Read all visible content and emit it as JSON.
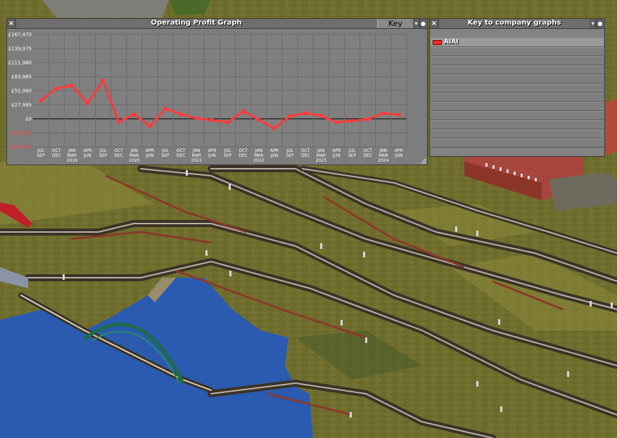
{
  "graph_window": {
    "title": "Operating Profit Graph",
    "key_label": "Key",
    "close_icon": "×"
  },
  "key_window": {
    "title": "Key to company graphs",
    "close_icon": "×",
    "items": [
      {
        "label": "AIAI",
        "color": "#ff3030"
      }
    ]
  },
  "chart_data": {
    "type": "line",
    "title": "Operating Profit Graph",
    "y_ticks": [
      "£167,470",
      "£139,975",
      "£111,980",
      "£83,985",
      "£55,990",
      "£27,995",
      "£0",
      "-£27,995",
      "-£55,990"
    ],
    "ylim": [
      -55990,
      167470
    ],
    "x_ticks": [
      [
        "JUL",
        "SEP",
        ""
      ],
      [
        "OCT",
        "DEC",
        ""
      ],
      [
        "JAN",
        "MAR",
        "2019"
      ],
      [
        "APR",
        "JUN",
        ""
      ],
      [
        "JUL",
        "SEP",
        ""
      ],
      [
        "OCT",
        "DEC",
        ""
      ],
      [
        "JAN",
        "MAR",
        "2020"
      ],
      [
        "APR",
        "JUN",
        ""
      ],
      [
        "JUL",
        "SEP",
        ""
      ],
      [
        "OCT",
        "DEC",
        ""
      ],
      [
        "JAN",
        "MAR",
        "2021"
      ],
      [
        "APR",
        "JUN",
        ""
      ],
      [
        "JUL",
        "SEP",
        ""
      ],
      [
        "OCT",
        "DEC",
        ""
      ],
      [
        "JAN",
        "MAR",
        "2022"
      ],
      [
        "APR",
        "JUN",
        ""
      ],
      [
        "JUL",
        "SEP",
        ""
      ],
      [
        "OCT",
        "DEC",
        ""
      ],
      [
        "JAN",
        "MAR",
        "2023"
      ],
      [
        "APR",
        "JUN",
        ""
      ],
      [
        "JUL",
        "SEP",
        ""
      ],
      [
        "OCT",
        "DEC",
        ""
      ],
      [
        "JAN",
        "MAR",
        "2024"
      ],
      [
        "APR",
        "JUN",
        ""
      ]
    ],
    "series": [
      {
        "name": "AIAI",
        "color": "#ff3a3a",
        "values": [
          36000,
          60000,
          66000,
          31000,
          76000,
          -6000,
          9000,
          -15000,
          20000,
          9000,
          1000,
          -3000,
          -7000,
          15000,
          -2000,
          -19000,
          5000,
          11000,
          6000,
          -7000,
          -4000,
          -1000,
          11000,
          8000
        ]
      }
    ],
    "grid": true
  }
}
